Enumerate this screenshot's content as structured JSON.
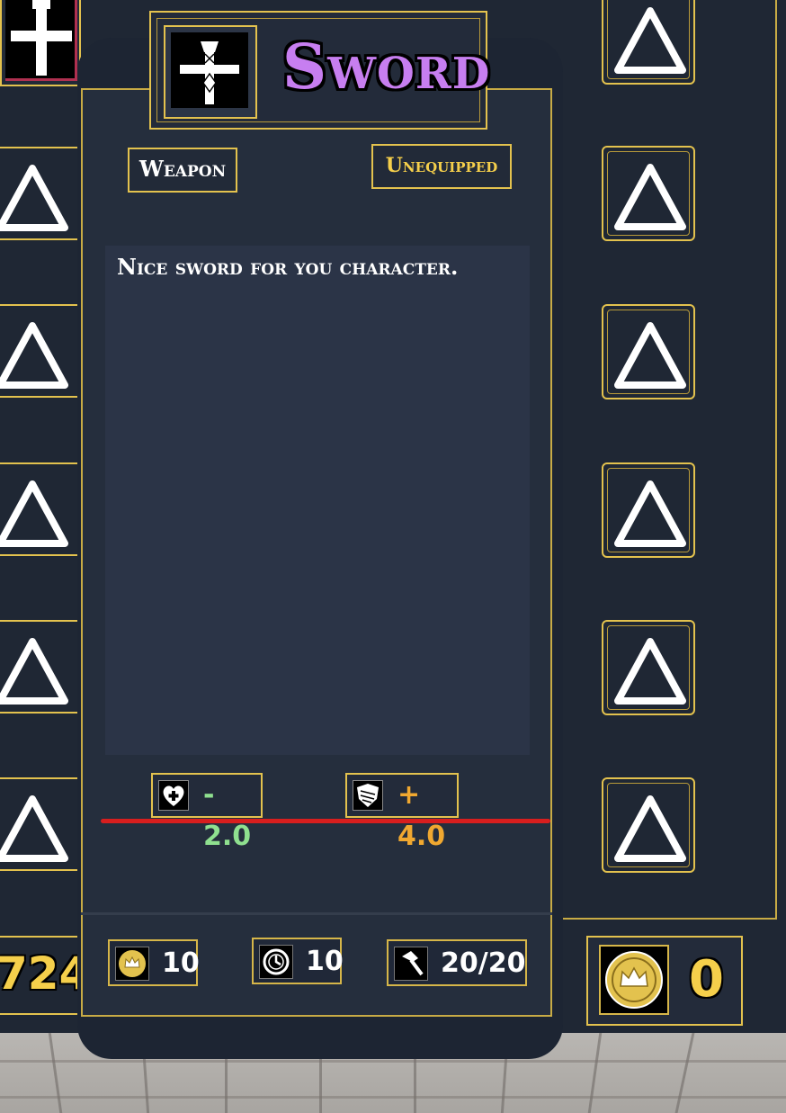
{
  "item": {
    "name": "Sword",
    "type": "Weapon",
    "status": "Unequipped",
    "description": "Nice sword for you character.",
    "icon": "sword-icon"
  },
  "stats": [
    {
      "name": "health",
      "icon": "heart-plus-icon",
      "value": "- 2.0",
      "color": "#8fe08f"
    },
    {
      "name": "armor",
      "icon": "shield-icon",
      "value": "+ 4.0",
      "color": "#f0a830"
    }
  ],
  "resources": {
    "coins": {
      "icon": "crown-coin-icon",
      "value": "10"
    },
    "time": {
      "icon": "clock-icon",
      "value": "10"
    },
    "durability": {
      "icon": "hammer-icon",
      "value": "20/20"
    }
  },
  "gold": {
    "icon": "crown-coin-icon",
    "value": "0"
  },
  "left_counter": "724",
  "colors": {
    "accent_gold": "#e3c24e",
    "title_purple": "#c77ef0",
    "status_yellow": "#f5cf4b",
    "alert_red": "#d81e1e"
  }
}
